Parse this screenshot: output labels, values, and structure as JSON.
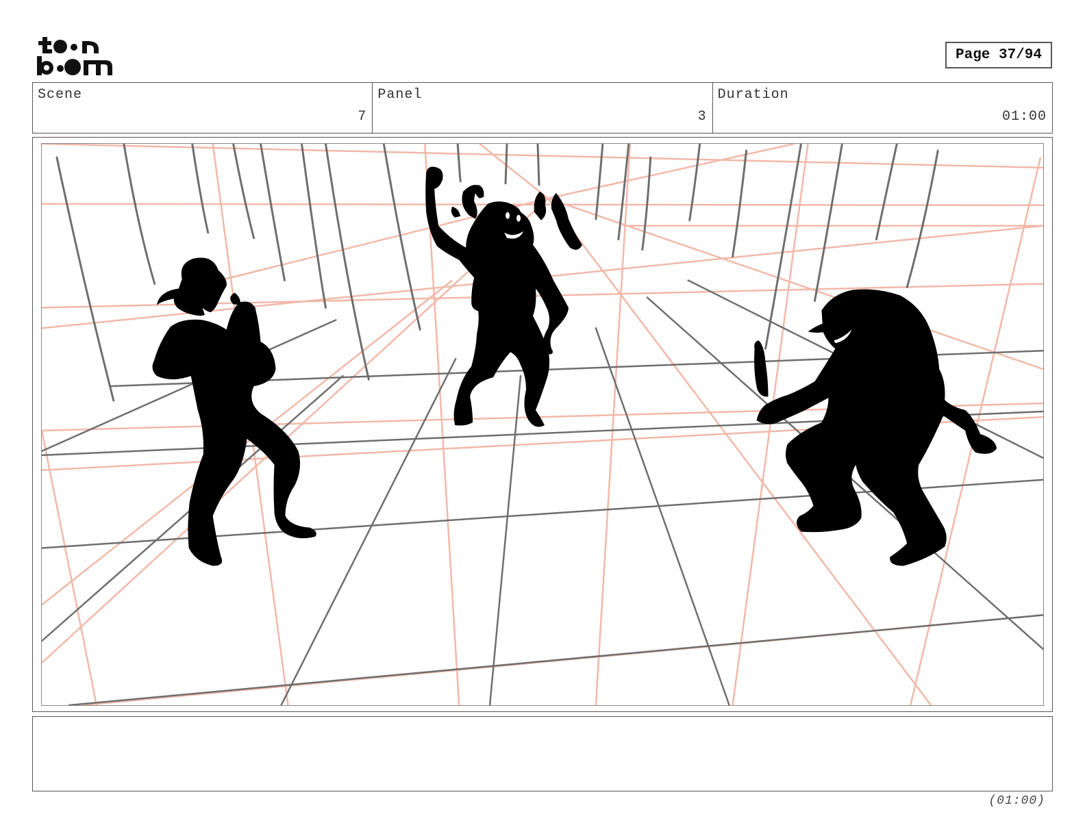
{
  "brand": {
    "logo_text": "toon boom"
  },
  "page": {
    "label": "Page 37/94"
  },
  "info": {
    "scene_label": "Scene",
    "scene_value": "7",
    "panel_label": "Panel",
    "panel_value": "3",
    "duration_label": "Duration",
    "duration_value": "01:00"
  },
  "caption": {
    "text": ""
  },
  "footer": {
    "duration": "(01:00)"
  },
  "colors": {
    "grid": "#6e6e6e",
    "perspective": "#f2b8a8",
    "silhouette": "#000000"
  }
}
